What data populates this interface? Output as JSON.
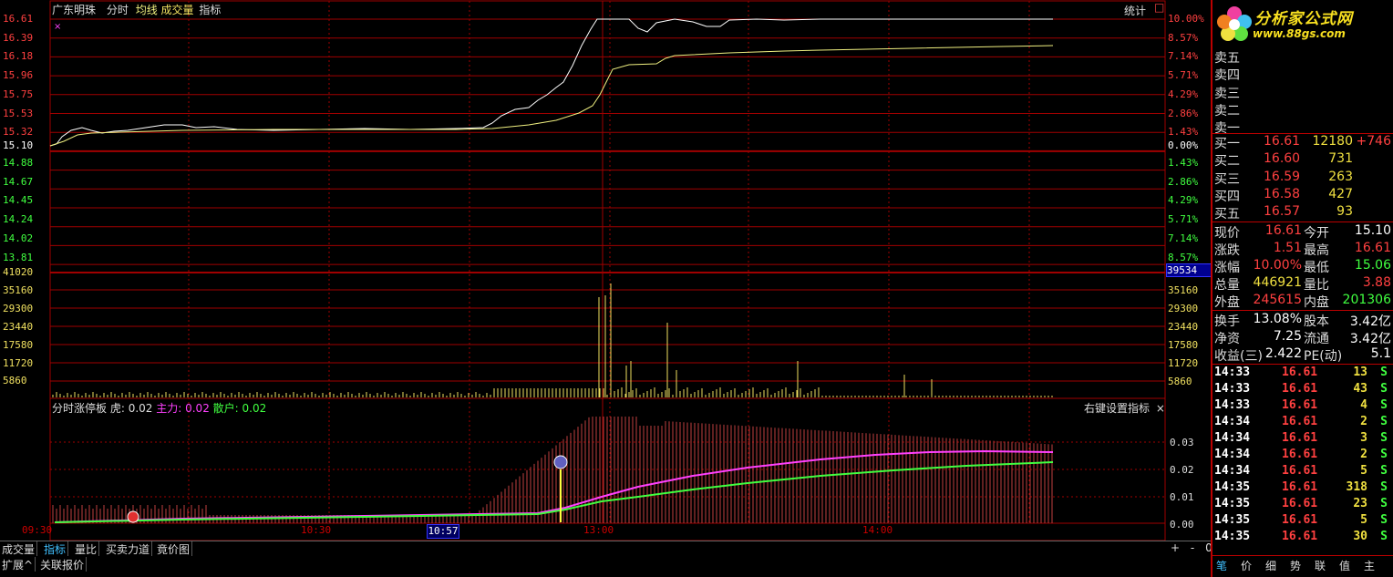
{
  "header": {
    "stock_name": "广东明珠",
    "mode": "分时",
    "avg_line": "均线",
    "volume": "成交量",
    "indicator": "指标",
    "stats_button": "统计",
    "close_box": "□"
  },
  "price_axis_left_up": [
    "16.61",
    "16.39",
    "16.18",
    "15.96",
    "15.75",
    "15.53",
    "15.32"
  ],
  "price_axis_mid": "15.10",
  "price_axis_left_down": [
    "14.88",
    "14.67",
    "14.45",
    "14.24",
    "14.02",
    "13.81"
  ],
  "pct_axis_up": [
    "10.00%",
    "8.57%",
    "7.14%",
    "5.71%",
    "4.29%",
    "2.86%",
    "1.43%"
  ],
  "pct_axis_mid": "0.00%",
  "pct_axis_down": [
    "1.43%",
    "2.86%",
    "4.29%",
    "5.71%",
    "7.14%",
    "8.57%"
  ],
  "vol_axis": [
    "41020",
    "35160",
    "29300",
    "23440",
    "17580",
    "11720",
    "5860"
  ],
  "vol_axis_right": [
    "35160",
    "29300",
    "23440",
    "17580",
    "11720",
    "5860"
  ],
  "vol_cursor_value": "39534",
  "indicator_header": {
    "name": "分时涨停板",
    "tiger_label": "虎: 0.02",
    "main_label": "主力: 0.02",
    "retail_label": "散户: 0.02",
    "settings": "右键设置指标",
    "close": "×"
  },
  "indicator_axis": [
    "0.03",
    "0.02",
    "0.01",
    "0.00"
  ],
  "time_axis": [
    "09:30",
    "10:30",
    "13:00",
    "14:00"
  ],
  "time_cursor": "10:57",
  "logo": {
    "title": "分析家公式网",
    "url": "www.88gs.com"
  },
  "sell_orders": [
    {
      "label": "卖五"
    },
    {
      "label": "卖四"
    },
    {
      "label": "卖三"
    },
    {
      "label": "卖二"
    },
    {
      "label": "卖一"
    }
  ],
  "buy_orders": [
    {
      "label": "买一",
      "price": "16.61",
      "vol": "12180",
      "chg": "+746"
    },
    {
      "label": "买二",
      "price": "16.60",
      "vol": "731",
      "chg": ""
    },
    {
      "label": "买三",
      "price": "16.59",
      "vol": "263",
      "chg": ""
    },
    {
      "label": "买四",
      "price": "16.58",
      "vol": "427",
      "chg": ""
    },
    {
      "label": "买五",
      "price": "16.57",
      "vol": "93",
      "chg": ""
    }
  ],
  "quote": [
    {
      "l1": "现价",
      "v1": "16.61",
      "l2": "今开",
      "v2": "15.10",
      "c1": "#ff4040",
      "c2": "#ffffff"
    },
    {
      "l1": "涨跌",
      "v1": "1.51",
      "l2": "最高",
      "v2": "16.61",
      "c1": "#ff4040",
      "c2": "#ff4040"
    },
    {
      "l1": "涨幅",
      "v1": "10.00%",
      "l2": "最低",
      "v2": "15.06",
      "c1": "#ff4040",
      "c2": "#40ff40"
    },
    {
      "l1": "总量",
      "v1": "446921",
      "l2": "量比",
      "v2": "3.88",
      "c1": "#f0e040",
      "c2": "#ff4040"
    },
    {
      "l1": "外盘",
      "v1": "245615",
      "l2": "内盘",
      "v2": "201306",
      "c1": "#ff4040",
      "c2": "#40ff40"
    }
  ],
  "finance": [
    {
      "l1": "换手",
      "v1": "13.08%",
      "l2": "股本",
      "v2": "3.42亿"
    },
    {
      "l1": "净资",
      "v1": "7.25",
      "l2": "流通",
      "v2": "3.42亿"
    },
    {
      "l1": "收益(三)",
      "v1": "2.422",
      "l2": "PE(动)",
      "v2": "5.1"
    }
  ],
  "ticks": [
    {
      "time": "14:33",
      "price": "16.61",
      "vol": "13",
      "side": "S"
    },
    {
      "time": "14:33",
      "price": "16.61",
      "vol": "43",
      "side": "S"
    },
    {
      "time": "14:33",
      "price": "16.61",
      "vol": "4",
      "side": "S"
    },
    {
      "time": "14:34",
      "price": "16.61",
      "vol": "2",
      "side": "S"
    },
    {
      "time": "14:34",
      "price": "16.61",
      "vol": "3",
      "side": "S"
    },
    {
      "time": "14:34",
      "price": "16.61",
      "vol": "2",
      "side": "S"
    },
    {
      "time": "14:34",
      "price": "16.61",
      "vol": "5",
      "side": "S"
    },
    {
      "time": "14:35",
      "price": "16.61",
      "vol": "318",
      "side": "S"
    },
    {
      "time": "14:35",
      "price": "16.61",
      "vol": "23",
      "side": "S"
    },
    {
      "time": "14:35",
      "price": "16.61",
      "vol": "5",
      "side": "S"
    },
    {
      "time": "14:35",
      "price": "16.61",
      "vol": "30",
      "side": "S"
    }
  ],
  "bottom_tabs": [
    "成交量",
    "指标",
    "量比",
    "买卖力道",
    "竟价图"
  ],
  "bottom_tabs2": [
    "扩展^",
    "关联报价"
  ],
  "right_tabs": [
    "笔",
    "价",
    "细",
    "势",
    "联",
    "值",
    "主"
  ],
  "zoom_controls": [
    "+",
    "-",
    "0"
  ],
  "colors": {
    "grid": "#a00000",
    "price_line": "#ffffff",
    "avg_line": "#f0f080",
    "up": "#ff4040",
    "down": "#40ff40",
    "volume_bar": "#f0e060",
    "main_line": "#ff40ff",
    "retail_line": "#40ff40",
    "indicator_bar": "#c04040"
  }
}
